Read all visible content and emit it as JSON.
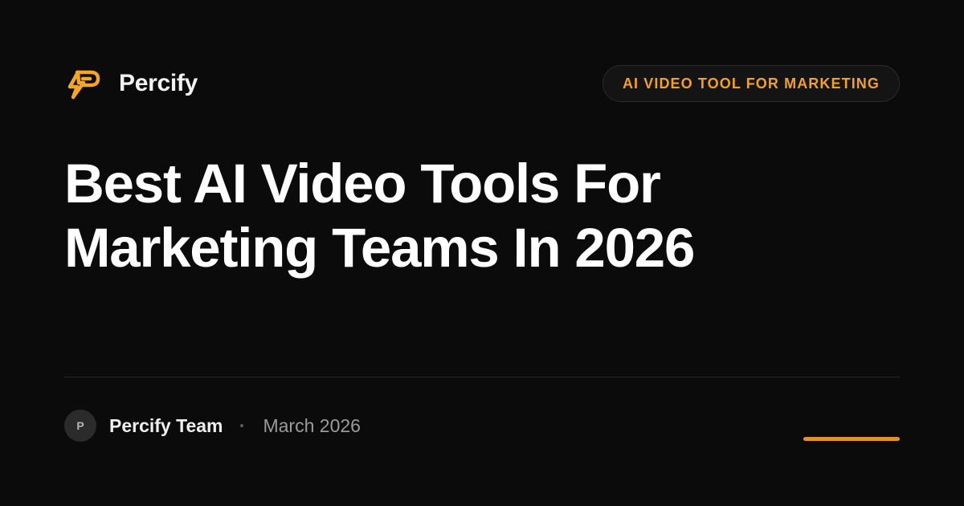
{
  "brand": {
    "name": "Percify",
    "logo_icon": "lightning-p-icon",
    "accent_color": "#f5a623"
  },
  "badge": {
    "label": "AI VIDEO TOOL FOR MARKETING",
    "color": "#f3a027"
  },
  "article": {
    "title_lines": [
      "Best AI Video Tools For",
      "Marketing Teams In 2026"
    ]
  },
  "footer": {
    "avatar_initial": "P",
    "author": "Percify Team",
    "separator": "·",
    "date": "March 2026"
  }
}
